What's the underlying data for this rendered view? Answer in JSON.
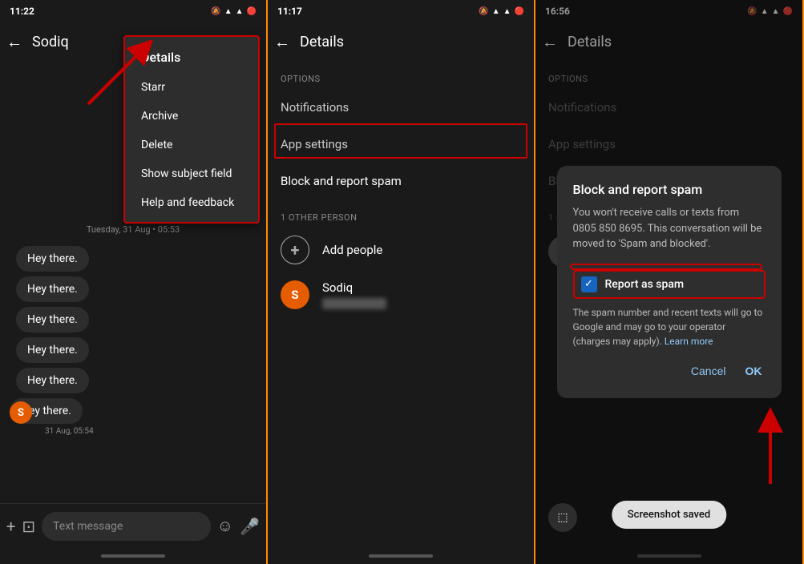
{
  "panel1": {
    "time": "11:22",
    "status_icons": "🔔📶📶🔋",
    "title": "Sodiq",
    "date_divider": "Tuesday, 31 Aug • 05:53",
    "messages": [
      "Hey there.",
      "Hey there.",
      "Hey there.",
      "Hey there.",
      "Hey there.",
      "Hey there."
    ],
    "msg_time": "31 Aug, 05:54",
    "input_placeholder": "Text message",
    "dropdown": {
      "title": "Details",
      "items": [
        "Starr",
        "Archive",
        "Delete",
        "Show subject field",
        "Help and feedback"
      ]
    }
  },
  "panel2": {
    "time": "11:17",
    "title": "Details",
    "options_label": "OPTIONS",
    "options": [
      "Notifications",
      "App settings",
      "Block and report spam"
    ],
    "other_label": "1 OTHER PERSON",
    "add_label": "Add people",
    "person_name": "Sodiq"
  },
  "panel3": {
    "time": "16:56",
    "title": "Details",
    "options_label": "OPTIONS",
    "options": [
      "Notifications",
      "App settings",
      "Block and report spam"
    ],
    "other_label": "1 OT",
    "dialog": {
      "title": "Block and report spam",
      "body": "You won't receive calls or texts from 0805 850 8695. This conversation will be moved to 'Spam and blocked'.",
      "checkbox_label": "Report as spam",
      "extra": "The spam number and recent texts will go to Google and may go to your operator (charges may apply).",
      "learn_more": "Learn more",
      "cancel": "Cancel",
      "ok": "OK"
    },
    "toast": "Screenshot saved",
    "screenshot_icon": "⬚"
  },
  "icons": {
    "back": "←",
    "add": "+",
    "emoji": "☺",
    "mic": "🎤",
    "attach": "📎",
    "camera": "📷",
    "check": "✓"
  }
}
